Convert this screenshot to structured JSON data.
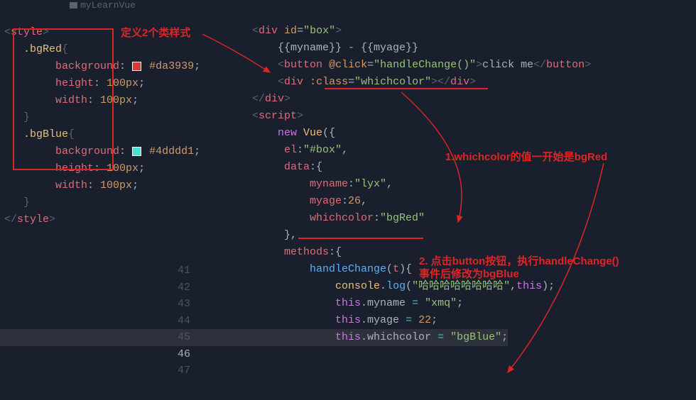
{
  "tab": {
    "folder_name": "myLearnVue"
  },
  "annotations": {
    "define_classes": "定义2个类样式",
    "ann_initial": "1.whichcolor的值一开始是bgRed",
    "ann_change_l1": "2. 点击button按钮，执行handleChange()",
    "ann_change_l2": "事件后修改为bgBlue"
  },
  "gutter": {
    "l41": "41",
    "l42": "42",
    "l43": "43",
    "l44": "44",
    "l45": "45",
    "l46": "46",
    "l47": "47"
  },
  "css": {
    "class1": ".bgRed",
    "class2": ".bgBlue",
    "bg_label": "background",
    "height_label": "height",
    "width_label": "width",
    "color1": "#da3939",
    "color2": "#4dddd1",
    "size": "100px",
    "style_open": "style",
    "style_close": "style"
  },
  "html": {
    "div": "div",
    "id_attr": "id",
    "id_val": "\"box\"",
    "myname_bind": "{{myname}}",
    "dash": " - ",
    "myage_bind": "{{myage}}",
    "button": "button",
    "click_attr": "@click",
    "click_val": "\"handleChange()\"",
    "click_text": "click me",
    "class_attr": ":class",
    "class_val": "\"whichcolor\""
  },
  "script": {
    "script_tag": "script",
    "new": "new",
    "vue": "Vue",
    "el": "el",
    "el_val": "\"#box\"",
    "data": "data",
    "myname": "myname",
    "myname_val": "\"lyx\"",
    "myage": "myage",
    "myage_val": "26",
    "whichcolor": "whichcolor",
    "whichcolor_val": "\"bgRed\"",
    "methods": "methods",
    "fn": "handleChange",
    "param": "t",
    "console": "console",
    "log": "log",
    "log_val": "\"哈哈哈哈哈哈哈哈\"",
    "this": "this",
    "assign_name_val": "\"xmq\"",
    "assign_age_val": "22",
    "assign_color_val": "\"bgBlue\""
  }
}
